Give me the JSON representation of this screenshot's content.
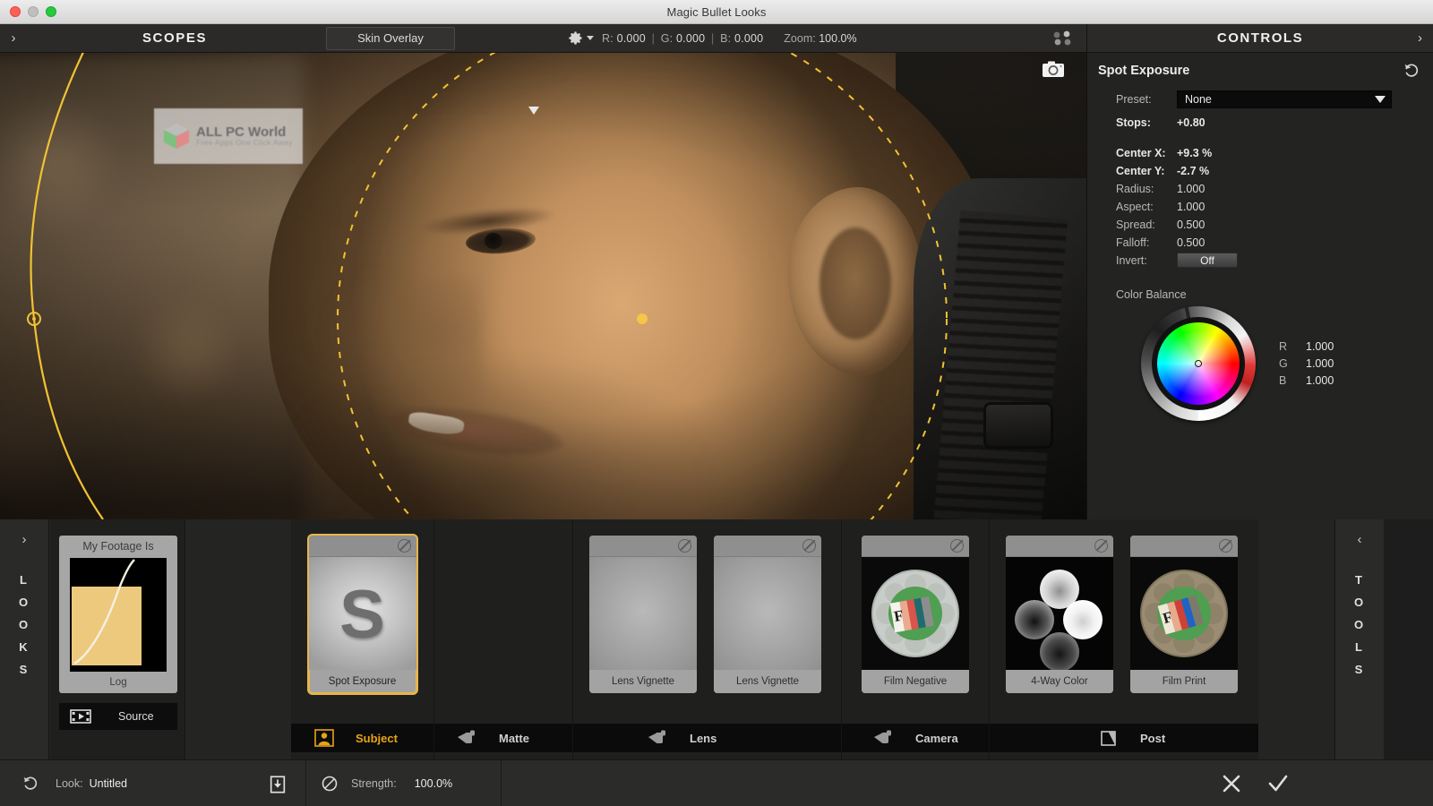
{
  "window": {
    "title": "Magic Bullet Looks"
  },
  "toolbar": {
    "expand_chevron": "›",
    "scopes_label": "SCOPES",
    "skin_overlay_label": "Skin Overlay",
    "gear_icon": "gear-icon",
    "readout": {
      "r_key": "R:",
      "r_value": "0.000",
      "g_key": "G:",
      "g_value": "0.000",
      "b_key": "B:",
      "b_value": "0.000",
      "zoom_key": "Zoom:",
      "zoom_value": "100.0%"
    }
  },
  "viewport": {
    "watermark": {
      "title": "ALL PC World",
      "subtitle": "Free Apps One Click Away"
    },
    "camera_icon": "camera-icon",
    "overlay": {
      "type": "spot-exposure-ellipse",
      "color": "#ffd24a"
    }
  },
  "controls": {
    "header_title": "CONTROLS",
    "collapse_chevron": "›",
    "effect_title": "Spot Exposure",
    "reset_icon": "reset-icon",
    "preset": {
      "label": "Preset:",
      "value": "None"
    },
    "stops": {
      "label": "Stops:",
      "value": "+0.80"
    },
    "params": [
      {
        "label": "Center X:",
        "value": "+9.3 %",
        "bold": true
      },
      {
        "label": "Center Y:",
        "value": "-2.7 %",
        "bold": true
      },
      {
        "label": "Radius:",
        "value": "1.000",
        "bold": false
      },
      {
        "label": "Aspect:",
        "value": "1.000",
        "bold": false
      },
      {
        "label": "Spread:",
        "value": "0.500",
        "bold": false
      },
      {
        "label": "Falloff:",
        "value": "0.500",
        "bold": false
      }
    ],
    "invert": {
      "label": "Invert:",
      "value": "Off"
    },
    "color_balance": {
      "title": "Color Balance",
      "channels": [
        {
          "name": "R",
          "value": "1.000"
        },
        {
          "name": "G",
          "value": "1.000"
        },
        {
          "name": "B",
          "value": "1.000"
        }
      ]
    }
  },
  "looks_panel": {
    "rail_label": "LOOKS",
    "rail_chevron": "›",
    "tools_rail_label": "TOOLS",
    "tools_chevron": "‹",
    "footage": {
      "card_title": "My Footage Is",
      "card_footer": "Log",
      "source_label": "Source",
      "source_icon": "film-strip-icon"
    },
    "groups": [
      {
        "category": "Subject",
        "active": true,
        "icon": "subject-icon",
        "cards": [
          {
            "label": "Spot Exposure",
            "selected": true,
            "thumb": "spot"
          }
        ]
      },
      {
        "category": "Matte",
        "active": false,
        "icon": "matte-icon",
        "cards": []
      },
      {
        "category": "Lens",
        "active": false,
        "icon": "lens-icon",
        "cards": [
          {
            "label": "Lens Vignette",
            "selected": false,
            "thumb": "vignette"
          },
          {
            "label": "Lens Vignette",
            "selected": false,
            "thumb": "vignette"
          }
        ]
      },
      {
        "category": "Camera",
        "active": false,
        "icon": "camera-body-icon",
        "cards": [
          {
            "label": "Film Negative",
            "selected": false,
            "thumb": "reel-negative"
          }
        ]
      },
      {
        "category": "Post",
        "active": false,
        "icon": "post-icon",
        "cards": [
          {
            "label": "4-Way Color",
            "selected": false,
            "thumb": "fourway"
          },
          {
            "label": "Film Print",
            "selected": false,
            "thumb": "reel-print"
          }
        ]
      }
    ]
  },
  "statusbar": {
    "undo_icon": "undo-icon",
    "look_label": "Look:",
    "look_value": "Untitled",
    "save_icon": "save-icon",
    "disable_icon": "disable-icon",
    "strength_label": "Strength:",
    "strength_value": "100.0%",
    "cancel_icon": "close-icon",
    "confirm_icon": "check-icon"
  }
}
